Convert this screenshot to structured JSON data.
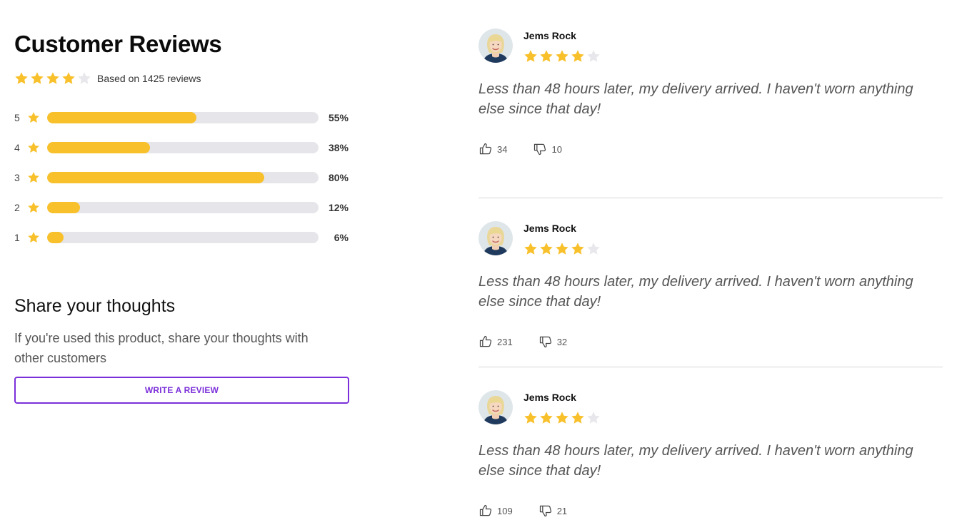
{
  "colors": {
    "star": "#f8c02a",
    "star_empty": "#e8e8ec",
    "accent": "#7b2fd9",
    "bar_track": "#e6e6ea"
  },
  "summary": {
    "title": "Customer Reviews",
    "rating": 4,
    "max_rating": 5,
    "based_on": "Based on 1425 reviews"
  },
  "distribution": [
    {
      "label": "5",
      "percent": 55,
      "percent_label": "55%"
    },
    {
      "label": "4",
      "percent": 38,
      "percent_label": "38%"
    },
    {
      "label": "3",
      "percent": 80,
      "percent_label": "80%"
    },
    {
      "label": "2",
      "percent": 12,
      "percent_label": "12%"
    },
    {
      "label": "1",
      "percent": 6,
      "percent_label": "6%"
    }
  ],
  "share": {
    "title": "Share your thoughts",
    "description": "If you're used this product, share your thoughts with other customers",
    "button_label": "WRITE A REVIEW"
  },
  "reviews": [
    {
      "name": "Jems Rock",
      "rating": 4,
      "text": "Less than 48 hours later, my delivery arrived. I haven't worn anything else since that day!",
      "likes": "34",
      "dislikes": "10"
    },
    {
      "name": "Jems Rock",
      "rating": 4,
      "text": "Less than 48 hours later, my delivery arrived. I haven't worn anything else since that day!",
      "likes": "231",
      "dislikes": "32"
    },
    {
      "name": "Jems Rock",
      "rating": 4,
      "text": "Less than 48 hours later, my delivery arrived. I haven't worn anything else since that day!",
      "likes": "109",
      "dislikes": "21"
    }
  ]
}
